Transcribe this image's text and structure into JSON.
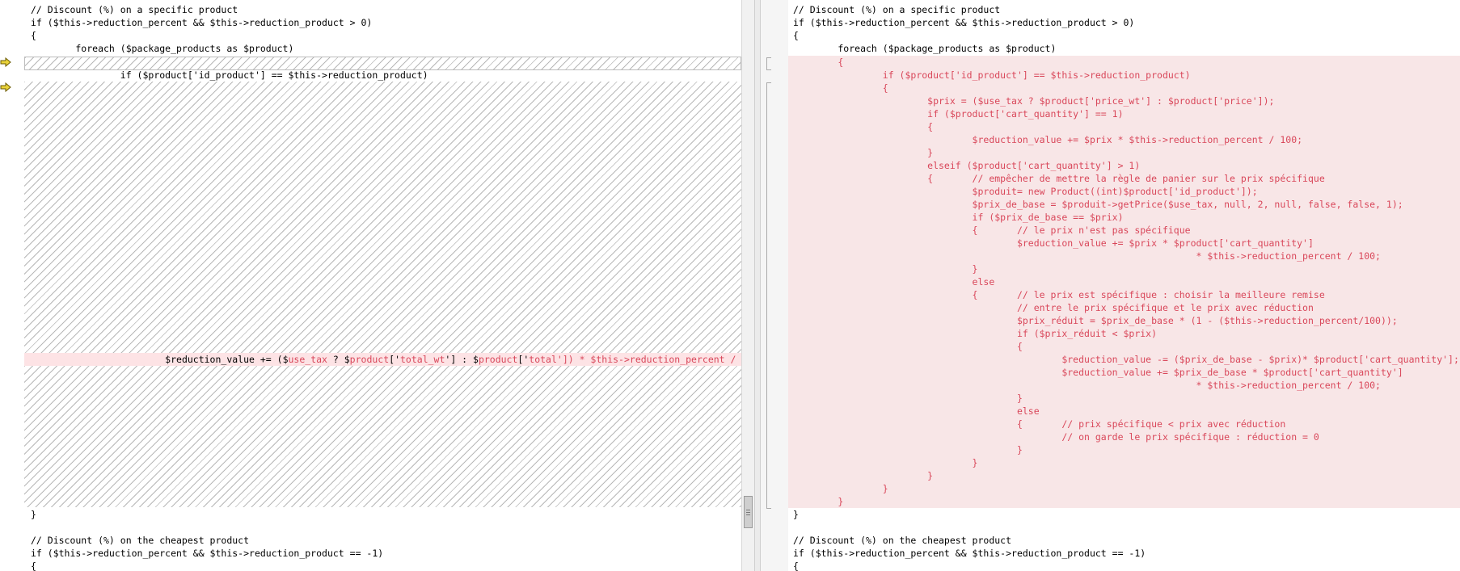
{
  "left_pane": {
    "lines": [
      "// Discount (%) on a specific product",
      "if ($this->reduction_percent && $this->reduction_product > 0)",
      "{",
      "        foreach ($package_products as $product)",
      "                if ($product['id_product'] == $this->reduction_product)",
      "}",
      "// Discount (%) on the cheapest product",
      "if ($this->reduction_percent && $this->reduction_product == -1)",
      "{"
    ],
    "changed_line_indent": "                        ",
    "changed_line_parts": [
      {
        "text": "$reduction_value += ($",
        "cls": "k"
      },
      {
        "text": "use_tax",
        "cls": "r"
      },
      {
        "text": " ? $",
        "cls": "k"
      },
      {
        "text": "product",
        "cls": "r"
      },
      {
        "text": "['",
        "cls": "k"
      },
      {
        "text": "total_wt",
        "cls": "r"
      },
      {
        "text": "'] : $",
        "cls": "k"
      },
      {
        "text": "product",
        "cls": "r"
      },
      {
        "text": "['",
        "cls": "k"
      },
      {
        "text": "total",
        "cls": "r"
      },
      {
        "text": "']) * $",
        "cls": "r"
      },
      {
        "text": "this->reduction_percent /",
        "cls": "r"
      }
    ]
  },
  "right_pane": {
    "lines_before": [
      "// Discount (%) on a specific product",
      "if ($this->reduction_percent && $this->reduction_product > 0)",
      "{",
      "        foreach ($package_products as $product)"
    ],
    "added_lines": [
      "        {",
      "                if ($product['id_product'] == $this->reduction_product)",
      "                {",
      "                        $prix = ($use_tax ? $product['price_wt'] : $product['price']);",
      "                        if ($product['cart_quantity'] == 1)",
      "                        {",
      "                                $reduction_value += $prix * $this->reduction_percent / 100;",
      "                        }",
      "                        elseif ($product['cart_quantity'] > 1)",
      "                        {       // empêcher de mettre la règle de panier sur le prix spécifique",
      "                                $produit= new Product((int)$product['id_product']);",
      "                                $prix_de_base = $produit->getPrice($use_tax, null, 2, null, false, false, 1);",
      "                                if ($prix_de_base == $prix)",
      "                                {       // le prix n'est pas spécifique",
      "                                        $reduction_value += $prix * $product['cart_quantity']",
      "                                                                        * $this->reduction_percent / 100;",
      "                                }",
      "                                else",
      "                                {       // le prix est spécifique : choisir la meilleure remise",
      "                                        // entre le prix spécifique et le prix avec réduction",
      "                                        $prix_réduit = $prix_de_base * (1 - ($this->reduction_percent/100));",
      "                                        if ($prix_réduit < $prix)",
      "                                        {",
      "                                                $reduction_value -= ($prix_de_base - $prix)* $product['cart_quantity'];",
      "                                                $reduction_value += $prix_de_base * $product['cart_quantity']",
      "                                                                        * $this->reduction_percent / 100;",
      "                                        }",
      "                                        else",
      "                                        {       // prix spécifique < prix avec réduction",
      "                                                // on garde le prix spécifique : réduction = 0",
      "                                        }",
      "                                }",
      "                        }",
      "                }",
      "        }"
    ],
    "lines_after": [
      "}",
      "",
      "// Discount (%) on the cheapest product",
      "if ($this->reduction_percent && $this->reduction_product == -1)",
      "{"
    ]
  },
  "colors": {
    "added_text": "#d9475a",
    "added_background": "#f8e6e7",
    "changed_line_background": "#fde3e5",
    "marker_arrow": "#e8c000"
  },
  "icons": [
    "arrow-right-icon",
    "arrow-right-icon"
  ]
}
